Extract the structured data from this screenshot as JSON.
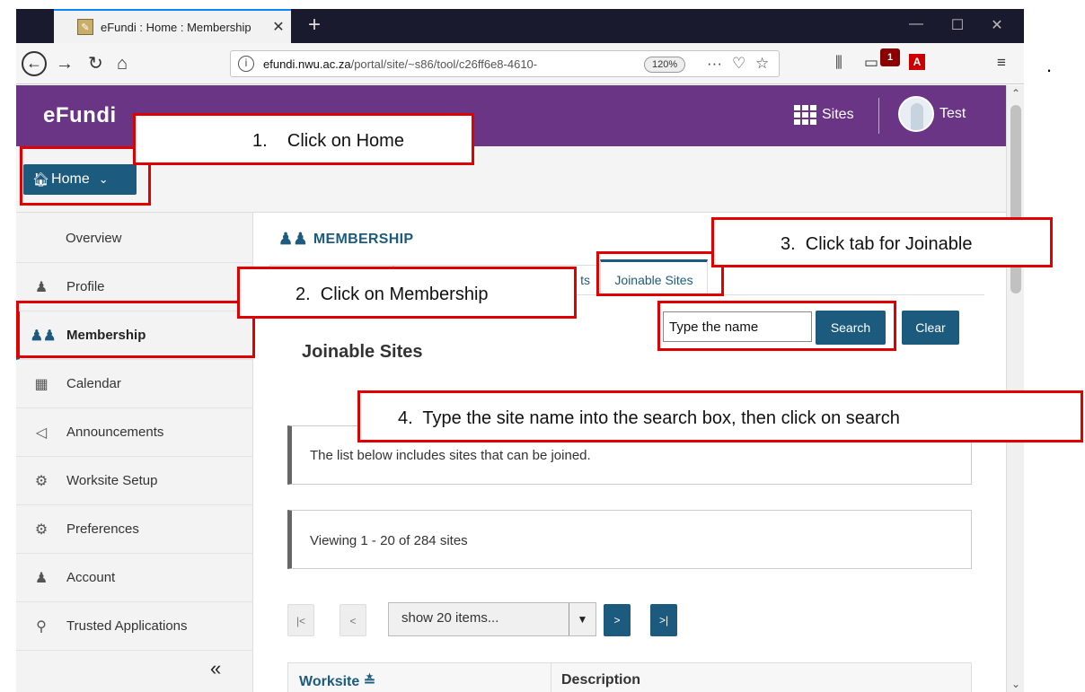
{
  "browser": {
    "tab_title": "eFundi : Home : Membership",
    "tab_close": "✕",
    "new_tab": "+",
    "url_host": "efundi.nwu.ac.za",
    "url_rest": "/portal/site/~s86/tool/c26ff6e8-4610-",
    "zoom": "120%",
    "extension_badge": "1",
    "stray_mark": "."
  },
  "header": {
    "logo": "eFundi",
    "sites_label": "Sites",
    "user_name": "Test"
  },
  "toolbar": {
    "home_label": "Home"
  },
  "sidebar": {
    "items": [
      {
        "label": "Overview",
        "icon": "none"
      },
      {
        "label": "Profile",
        "icon": "person-icon"
      },
      {
        "label": "Membership",
        "icon": "people-icon",
        "active": true
      },
      {
        "label": "Calendar",
        "icon": "calendar-icon"
      },
      {
        "label": "Announcements",
        "icon": "megaphone-icon"
      },
      {
        "label": "Worksite Setup",
        "icon": "gears-icon"
      },
      {
        "label": "Preferences",
        "icon": "gear-icon"
      },
      {
        "label": "Account",
        "icon": "person-icon"
      },
      {
        "label": "Trusted Applications",
        "icon": "key-icon"
      }
    ],
    "collapse": "«"
  },
  "main": {
    "title": "MEMBERSHIP",
    "tab_partial_text": "ts",
    "tab_active": "Joinable Sites",
    "search_placeholder": "Type the name",
    "search_button": "Search",
    "clear_button": "Clear",
    "section_title": "Joinable Sites",
    "info_text": "The list below includes sites that can be joined.",
    "viewing_text": "Viewing 1 - 20 of 284 sites",
    "pager": {
      "first": "|<",
      "prev": "<",
      "page_size": "show 20 items...",
      "next": ">",
      "last": ">|"
    },
    "table": {
      "columns": [
        "Worksite",
        "Description"
      ],
      "sort_glyph": "≛"
    }
  },
  "annotations": {
    "step1": "1.    Click on Home",
    "step2": "2.  Click on Membership",
    "step3": "3.  Click tab for Joinable",
    "step4": "4.  Type the site name into the search box, then click on search",
    "color": "#e00000"
  },
  "colors": {
    "brand_purple": "#6a3585",
    "accent_blue": "#1c5a7e"
  }
}
